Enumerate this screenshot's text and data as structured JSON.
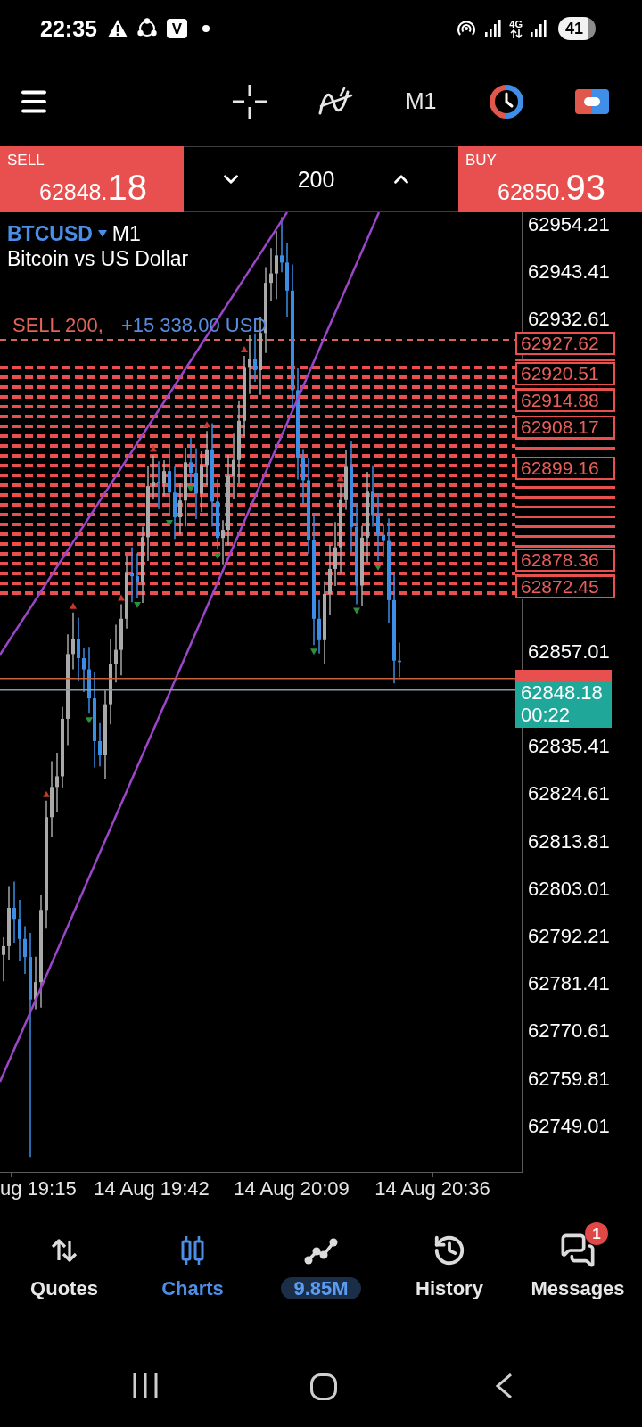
{
  "status_bar": {
    "time": "22:35",
    "app_badge": "V",
    "network": "4G",
    "battery": "41"
  },
  "toolbar": {
    "timeframe": "M1"
  },
  "trade_panel": {
    "sell": {
      "label": "SELL",
      "price": "62848.",
      "price_tail": "18"
    },
    "volume": "200",
    "buy": {
      "label": "BUY",
      "price": "62850.",
      "price_tail": "93"
    }
  },
  "chart": {
    "symbol": "BTCUSD",
    "timeframe": "M1",
    "description": "Bitcoin vs US Dollar",
    "position": {
      "label": "SELL 200,",
      "profit": "+15 338.00 USD"
    },
    "price_axis": [
      "62954.21",
      "62943.41",
      "62932.61",
      "62857.01",
      "62835.41",
      "62824.61",
      "62813.81",
      "62803.01",
      "62792.21",
      "62781.41",
      "62770.61",
      "62759.81",
      "62749.01"
    ],
    "order_tags": [
      "62927.62",
      "62920.51",
      "62914.88",
      "62908.17",
      "62899.16",
      "62878.36",
      "62872.45"
    ],
    "bid": {
      "price": "62848.18",
      "countdown": "00:22"
    },
    "time_axis": [
      "ug 19:15",
      "14 Aug 19:42",
      "14 Aug 20:09",
      "14 Aug 20:36"
    ]
  },
  "nav": [
    {
      "label": "Quotes",
      "kind": "tab",
      "selected": false
    },
    {
      "label": "Charts",
      "kind": "tab",
      "selected": true
    },
    {
      "label": "9.85M",
      "kind": "pill",
      "selected": false
    },
    {
      "label": "History",
      "kind": "tab",
      "selected": false
    },
    {
      "label": "Messages",
      "kind": "tab",
      "selected": false,
      "badge": "1"
    }
  ]
}
